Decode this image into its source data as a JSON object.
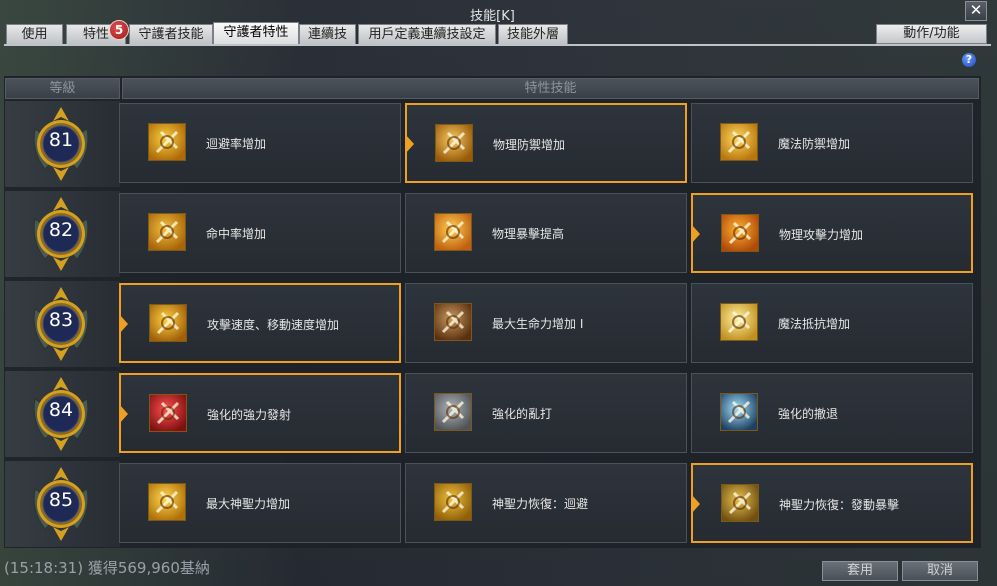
{
  "window": {
    "title": "技能[K]",
    "close_label": "✕"
  },
  "tabs": [
    {
      "label": "使用"
    },
    {
      "label": "特性"
    },
    {
      "label": "守護者技能"
    },
    {
      "label": "守護者特性"
    },
    {
      "label": "連續技"
    },
    {
      "label": "用戶定義連續技設定"
    },
    {
      "label": "技能外層"
    }
  ],
  "active_tab": "守護者特性",
  "tab_badge": {
    "count": "5"
  },
  "action_button": {
    "label": "動作/功能"
  },
  "help": {
    "label": "?"
  },
  "table": {
    "level_header": "等級",
    "skill_header": "特性技能"
  },
  "rows": [
    {
      "level": "81",
      "skills": [
        {
          "label": "迴避率增加",
          "icon": "dodge-icon",
          "selected": false
        },
        {
          "label": "物理防禦增加",
          "icon": "physical-defense-icon",
          "selected": true
        },
        {
          "label": "魔法防禦增加",
          "icon": "magic-defense-icon",
          "selected": false
        }
      ]
    },
    {
      "level": "82",
      "skills": [
        {
          "label": "命中率增加",
          "icon": "accuracy-icon",
          "selected": false
        },
        {
          "label": "物理暴擊提高",
          "icon": "physical-critical-icon",
          "selected": false
        },
        {
          "label": "物理攻擊力增加",
          "icon": "physical-attack-icon",
          "selected": true
        }
      ]
    },
    {
      "level": "83",
      "skills": [
        {
          "label": "攻擊速度、移動速度增加",
          "icon": "speed-icon",
          "selected": true
        },
        {
          "label": "最大生命力增加 I",
          "icon": "max-hp-icon",
          "selected": false
        },
        {
          "label": "魔法抵抗增加",
          "icon": "magic-resist-icon",
          "selected": false
        }
      ]
    },
    {
      "level": "84",
      "skills": [
        {
          "label": "強化的強力發射",
          "icon": "power-shot-icon",
          "selected": true
        },
        {
          "label": "強化的亂打",
          "icon": "flurry-icon",
          "selected": false
        },
        {
          "label": "強化的撤退",
          "icon": "retreat-icon",
          "selected": false
        }
      ]
    },
    {
      "level": "85",
      "skills": [
        {
          "label": "最大神聖力增加",
          "icon": "max-divine-power-icon",
          "selected": false
        },
        {
          "label": "神聖力恢復：迴避",
          "icon": "divine-recovery-dodge-icon",
          "selected": false
        },
        {
          "label": "神聖力恢復：發動暴擊",
          "icon": "divine-recovery-critical-icon",
          "selected": true
        }
      ]
    }
  ],
  "footer": {
    "chat_text": "(15:18:31) 獲得569,960基納",
    "apply_label": "套用",
    "cancel_label": "取消"
  },
  "colors": {
    "selection": "#f0a020",
    "badge": "#c02828",
    "level_medal": "#1e2a55",
    "gold": "#d4a020"
  }
}
